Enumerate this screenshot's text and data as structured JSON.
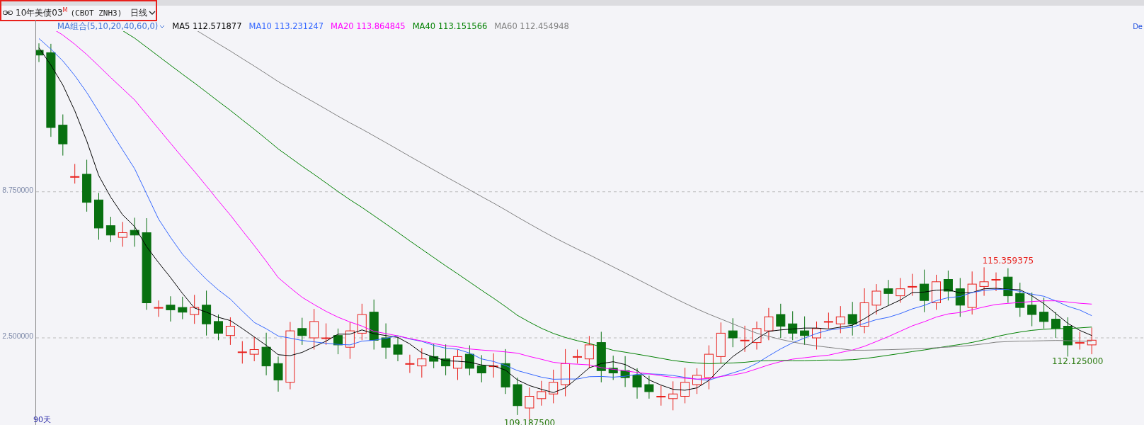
{
  "header": {
    "title": "10年美债03$^{M}$",
    "symbol": "(CBOT ZNH3)",
    "period": "日线"
  },
  "legend": {
    "group": "MA组合(5,10,20,40,60,0)",
    "items": [
      {
        "label": "MA5 112.571877",
        "color": "#000000"
      },
      {
        "label": "MA10 113.231247",
        "color": "#3366ff"
      },
      {
        "label": "MA20 113.864845",
        "color": "#ff00ff"
      },
      {
        "label": "MA40 113.151566",
        "color": "#008000"
      },
      {
        "label": "MA60 112.454948",
        "color": "#808080"
      }
    ]
  },
  "right_label": "De",
  "y_axis": [
    "8.750000",
    "2.500000"
  ],
  "x_axis_label": "90天",
  "annotations": [
    {
      "kind": "high",
      "text": "115.359375"
    },
    {
      "kind": "low",
      "text": "109.187500"
    },
    {
      "kind": "last",
      "text": "112.125000"
    }
  ]
}
